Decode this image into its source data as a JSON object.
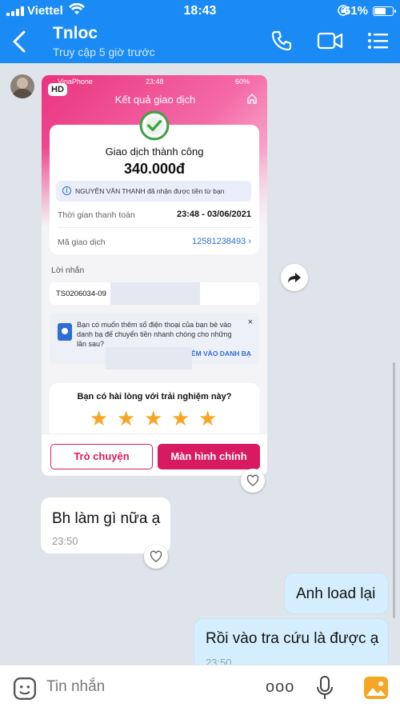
{
  "status_bar": {
    "carrier": "Viettel",
    "time": "18:43",
    "battery": "61%"
  },
  "header": {
    "contact_name": "Tnloc",
    "last_seen": "Truy cập 5 giờ trước"
  },
  "colors": {
    "header_blue": "#1a8bf4",
    "brand_pink": "#d81b60",
    "outgoing_bubble": "#d5eefd",
    "star": "#f6a623"
  },
  "shared_image": {
    "hd_badge": "HD",
    "inner_status": {
      "carrier": "VinaPhone",
      "time": "23:48",
      "battery": "60%"
    },
    "page_title": "Kết quả giao dịch",
    "result_status": "Giao dịch thành công",
    "amount": "340.000đ",
    "notice": "NGUYỄN VĂN THANH đã nhận được tiền từ bạn",
    "rows": [
      {
        "label": "Thời gian thanh toán",
        "value": "23:48 - 03/06/2021"
      },
      {
        "label": "Mã giao dịch",
        "value": "12581238493 ›"
      }
    ],
    "message_label": "Lời nhắn",
    "message_value": "TS0206034-09",
    "promo_text": "Bạn có muốn thêm số điện thoại của bạn bè vào danh bạ để chuyển tiền nhanh chóng cho những lần sau?",
    "promo_close": "×",
    "promo_link": "ÊM VÀO DANH BẠ",
    "rating_question": "Bạn có hài lòng với trải nghiệm này?",
    "rating_stars": 5,
    "buttons": {
      "chat": "Trò chuyện",
      "home": "Màn hình chính"
    }
  },
  "messages": [
    {
      "direction": "in",
      "text": "Bh làm gì nữa ạ",
      "time": "23:50"
    },
    {
      "direction": "out",
      "text": "Anh load lại"
    },
    {
      "direction": "out",
      "text": "Rồi vào tra cứu là được ạ",
      "time": "23:50"
    }
  ],
  "composer": {
    "placeholder": "Tin nhắn",
    "more": "ooo"
  }
}
